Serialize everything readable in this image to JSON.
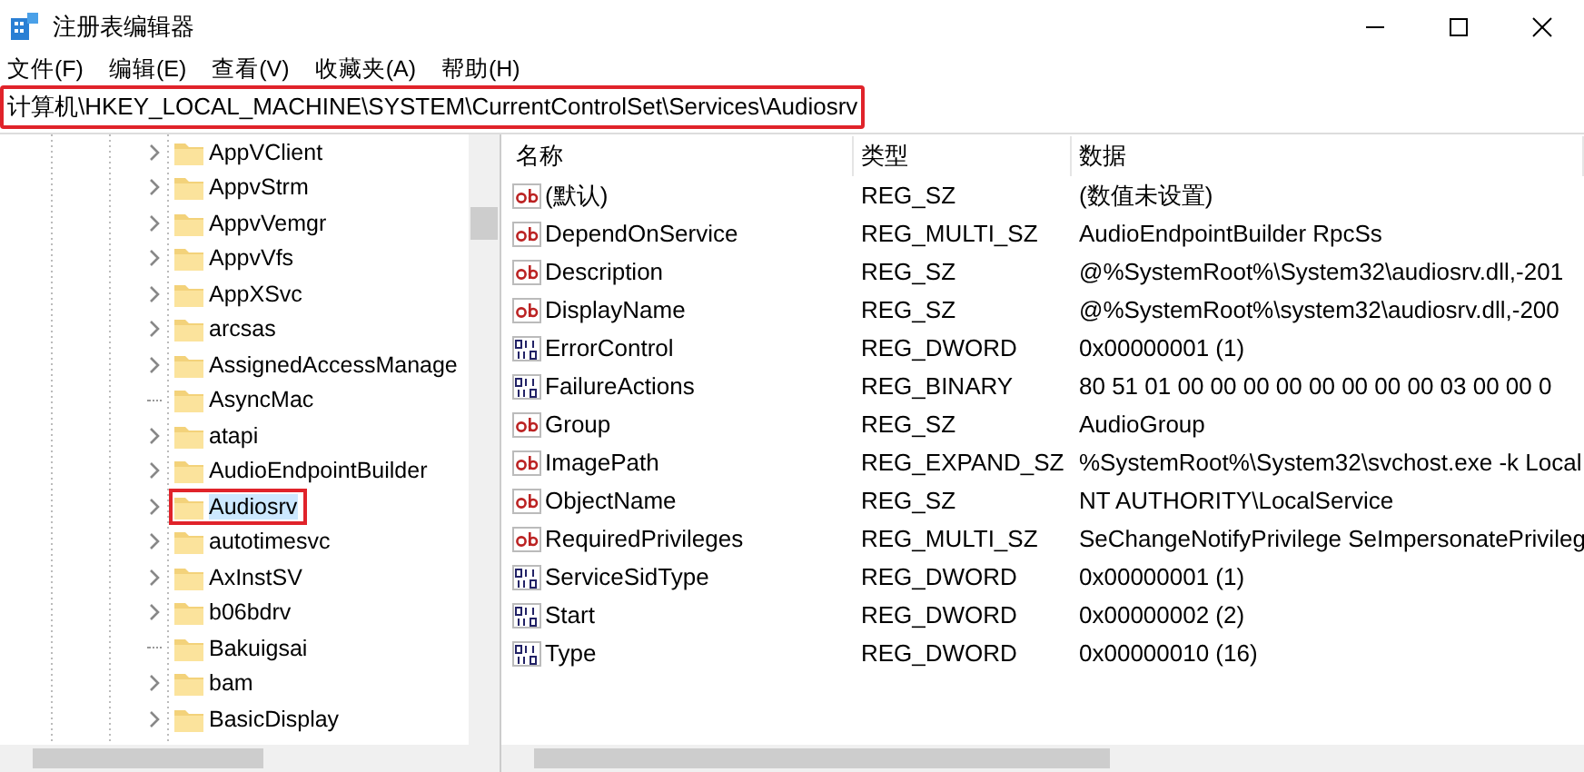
{
  "window": {
    "title": "注册表编辑器"
  },
  "menu": [
    "文件(F)",
    "编辑(E)",
    "查看(V)",
    "收藏夹(A)",
    "帮助(H)"
  ],
  "address_bar": {
    "value": "计算机\\HKEY_LOCAL_MACHINE\\SYSTEM\\CurrentControlSet\\Services\\Audiosrv",
    "highlighted": true
  },
  "tree": {
    "items": [
      {
        "label": "AppVClient",
        "has_children": true,
        "selected": false,
        "highlighted": false
      },
      {
        "label": "AppvStrm",
        "has_children": true,
        "selected": false,
        "highlighted": false
      },
      {
        "label": "AppvVemgr",
        "has_children": true,
        "selected": false,
        "highlighted": false
      },
      {
        "label": "AppvVfs",
        "has_children": true,
        "selected": false,
        "highlighted": false
      },
      {
        "label": "AppXSvc",
        "has_children": true,
        "selected": false,
        "highlighted": false
      },
      {
        "label": "arcsas",
        "has_children": true,
        "selected": false,
        "highlighted": false
      },
      {
        "label": "AssignedAccessManage",
        "has_children": true,
        "selected": false,
        "highlighted": false
      },
      {
        "label": "AsyncMac",
        "has_children": false,
        "selected": false,
        "highlighted": false
      },
      {
        "label": "atapi",
        "has_children": true,
        "selected": false,
        "highlighted": false
      },
      {
        "label": "AudioEndpointBuilder",
        "has_children": true,
        "selected": false,
        "highlighted": false
      },
      {
        "label": "Audiosrv",
        "has_children": true,
        "selected": true,
        "highlighted": true
      },
      {
        "label": "autotimesvc",
        "has_children": true,
        "selected": false,
        "highlighted": false
      },
      {
        "label": "AxInstSV",
        "has_children": true,
        "selected": false,
        "highlighted": false
      },
      {
        "label": "b06bdrv",
        "has_children": true,
        "selected": false,
        "highlighted": false
      },
      {
        "label": "Bakuigsai",
        "has_children": false,
        "selected": false,
        "highlighted": false
      },
      {
        "label": "bam",
        "has_children": true,
        "selected": false,
        "highlighted": false
      },
      {
        "label": "BasicDisplay",
        "has_children": true,
        "selected": false,
        "highlighted": false
      }
    ]
  },
  "values": {
    "columns": [
      "名称",
      "类型",
      "数据"
    ],
    "rows": [
      {
        "kind": "string",
        "name": "(默认)",
        "type": "REG_SZ",
        "data": "(数值未设置)"
      },
      {
        "kind": "string",
        "name": "DependOnService",
        "type": "REG_MULTI_SZ",
        "data": "AudioEndpointBuilder RpcSs"
      },
      {
        "kind": "string",
        "name": "Description",
        "type": "REG_SZ",
        "data": "@%SystemRoot%\\System32\\audiosrv.dll,-201"
      },
      {
        "kind": "string",
        "name": "DisplayName",
        "type": "REG_SZ",
        "data": "@%SystemRoot%\\system32\\audiosrv.dll,-200"
      },
      {
        "kind": "binary",
        "name": "ErrorControl",
        "type": "REG_DWORD",
        "data": "0x00000001 (1)"
      },
      {
        "kind": "binary",
        "name": "FailureActions",
        "type": "REG_BINARY",
        "data": "80 51 01 00 00 00 00 00 00 00 00 03 00 00 0"
      },
      {
        "kind": "string",
        "name": "Group",
        "type": "REG_SZ",
        "data": "AudioGroup"
      },
      {
        "kind": "string",
        "name": "ImagePath",
        "type": "REG_EXPAND_SZ",
        "data": "%SystemRoot%\\System32\\svchost.exe -k Local"
      },
      {
        "kind": "string",
        "name": "ObjectName",
        "type": "REG_SZ",
        "data": "NT AUTHORITY\\LocalService"
      },
      {
        "kind": "string",
        "name": "RequiredPrivileges",
        "type": "REG_MULTI_SZ",
        "data": "SeChangeNotifyPrivilege SeImpersonatePrivileg"
      },
      {
        "kind": "binary",
        "name": "ServiceSidType",
        "type": "REG_DWORD",
        "data": "0x00000001 (1)"
      },
      {
        "kind": "binary",
        "name": "Start",
        "type": "REG_DWORD",
        "data": "0x00000002 (2)"
      },
      {
        "kind": "binary",
        "name": "Type",
        "type": "REG_DWORD",
        "data": "0x00000010 (16)"
      }
    ]
  }
}
